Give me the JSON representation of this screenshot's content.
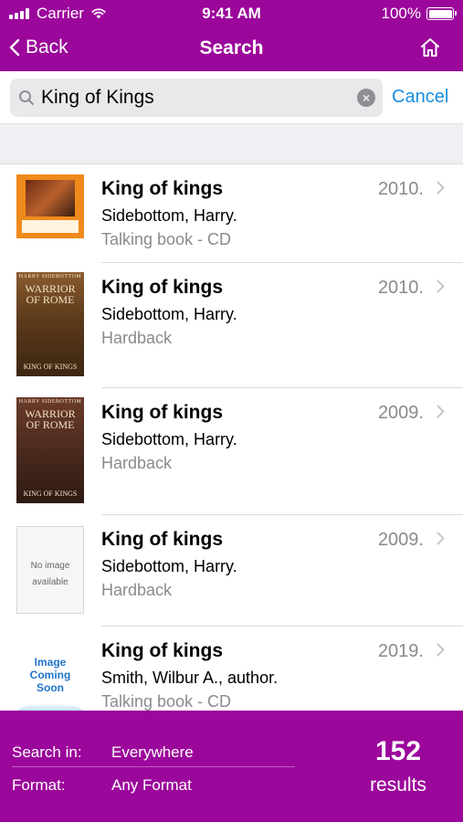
{
  "status_bar": {
    "carrier": "Carrier",
    "time": "9:41 AM",
    "battery": "100%"
  },
  "nav": {
    "back_label": "Back",
    "title": "Search",
    "home_icon": "home-icon"
  },
  "search": {
    "query": "King of Kings",
    "cancel_label": "Cancel",
    "clear_icon": "clear-icon"
  },
  "results": [
    {
      "title": "King of kings",
      "author": "Sidebottom, Harry.",
      "format": "Talking book - CD",
      "year": "2010."
    },
    {
      "title": "King of kings",
      "author": "Sidebottom, Harry.",
      "format": "Hardback",
      "year": "2010."
    },
    {
      "title": "King of kings",
      "author": "Sidebottom, Harry.",
      "format": "Hardback",
      "year": "2009."
    },
    {
      "title": "King of kings",
      "author": "Sidebottom, Harry.",
      "format": "Hardback",
      "year": "2009."
    },
    {
      "title": "King of kings",
      "author": "Smith, Wilbur A., author.",
      "format": "Talking book - CD",
      "year": "2019."
    }
  ],
  "covers": {
    "warrior_top": "HARRY SIDEBOTTOM",
    "warrior_title_1": "WARRIOR",
    "warrior_title_2": "OF ROME",
    "warrior_bottom": "KING OF KINGS",
    "no_image_1": "No image",
    "no_image_2": "available",
    "coming_1": "Image",
    "coming_2": "Coming",
    "coming_3": "Soon"
  },
  "footer": {
    "search_in_label": "Search in:",
    "search_in_value": "Everywhere",
    "format_label": "Format:",
    "format_value": "Any Format",
    "count": "152",
    "count_label": "results"
  },
  "colors": {
    "brand": "#9b069b",
    "link": "#1a8ee0"
  }
}
